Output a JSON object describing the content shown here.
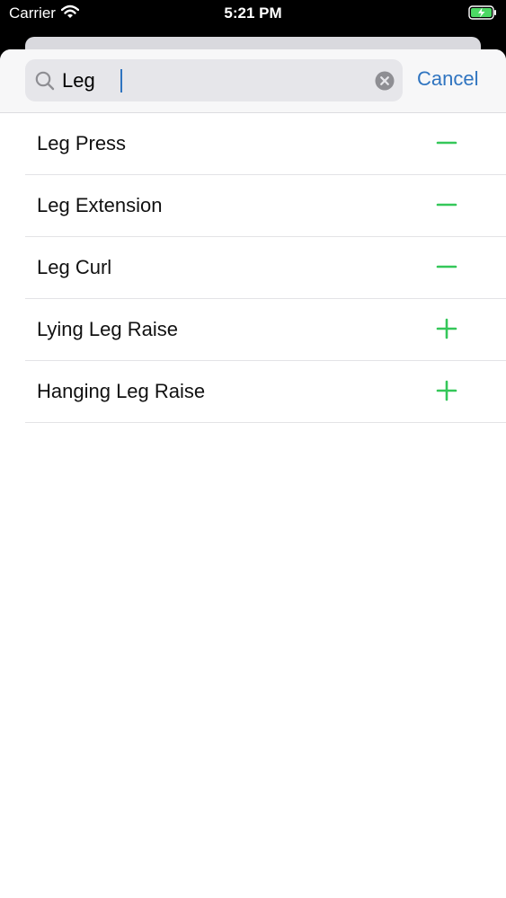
{
  "status_bar": {
    "carrier": "Carrier",
    "time": "5:21 PM",
    "wifi_icon": "wifi-icon",
    "battery_icon": "battery-charging-icon"
  },
  "search": {
    "value": "Leg",
    "search_icon": "search-icon",
    "clear_icon": "clear-icon",
    "cancel_label": "Cancel"
  },
  "colors": {
    "accent": "#2f74c0",
    "action_green": "#34c759"
  },
  "exercises": [
    {
      "label": "Leg Press",
      "action": "remove"
    },
    {
      "label": "Leg Extension",
      "action": "remove"
    },
    {
      "label": "Leg Curl",
      "action": "remove"
    },
    {
      "label": "Lying Leg Raise",
      "action": "add"
    },
    {
      "label": "Hanging Leg Raise",
      "action": "add"
    }
  ]
}
